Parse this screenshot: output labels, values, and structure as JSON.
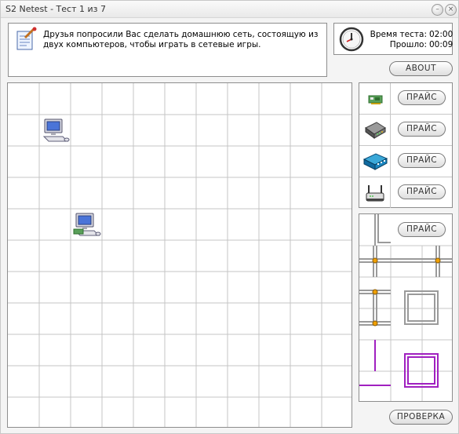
{
  "window": {
    "title": "S2 Netest - Тест 1 из 7"
  },
  "question": {
    "text": "Друзья попросили Вас сделать домашнюю сеть, состоящую из двух компьютеров, чтобы играть в сетевые игры.",
    "icon": "notepad-pencil-icon"
  },
  "timer": {
    "icon": "clock-icon",
    "total_label": "Время теста:",
    "total_value": "02:00",
    "elapsed_label": "Прошло:",
    "elapsed_value": "00:09"
  },
  "buttons": {
    "about": "ABOUT",
    "check": "ПРОВЕРКА"
  },
  "board": {
    "grid": {
      "columns": 11,
      "rows": 11
    },
    "items": [
      {
        "kind": "computer",
        "icon": "computer-icon",
        "col": 1,
        "row": 1,
        "with_nic": false
      },
      {
        "kind": "computer",
        "icon": "computer-with-network-card-icon",
        "col": 2,
        "row": 4,
        "with_nic": true
      }
    ]
  },
  "palette": {
    "items": [
      {
        "name": "network-card",
        "icon": "network-card-icon",
        "price_label": "ПРАЙС"
      },
      {
        "name": "modem",
        "icon": "modem-icon",
        "price_label": "ПРАЙС"
      },
      {
        "name": "switch",
        "icon": "switch-icon",
        "price_label": "ПРАЙС"
      },
      {
        "name": "router",
        "icon": "router-icon",
        "price_label": "ПРАЙС"
      }
    ]
  },
  "cables": {
    "price_label": "ПРАЙС",
    "colors": {
      "gray": "#9a9a9a",
      "purple": "#a020c0",
      "connector": "#f0a000"
    }
  }
}
